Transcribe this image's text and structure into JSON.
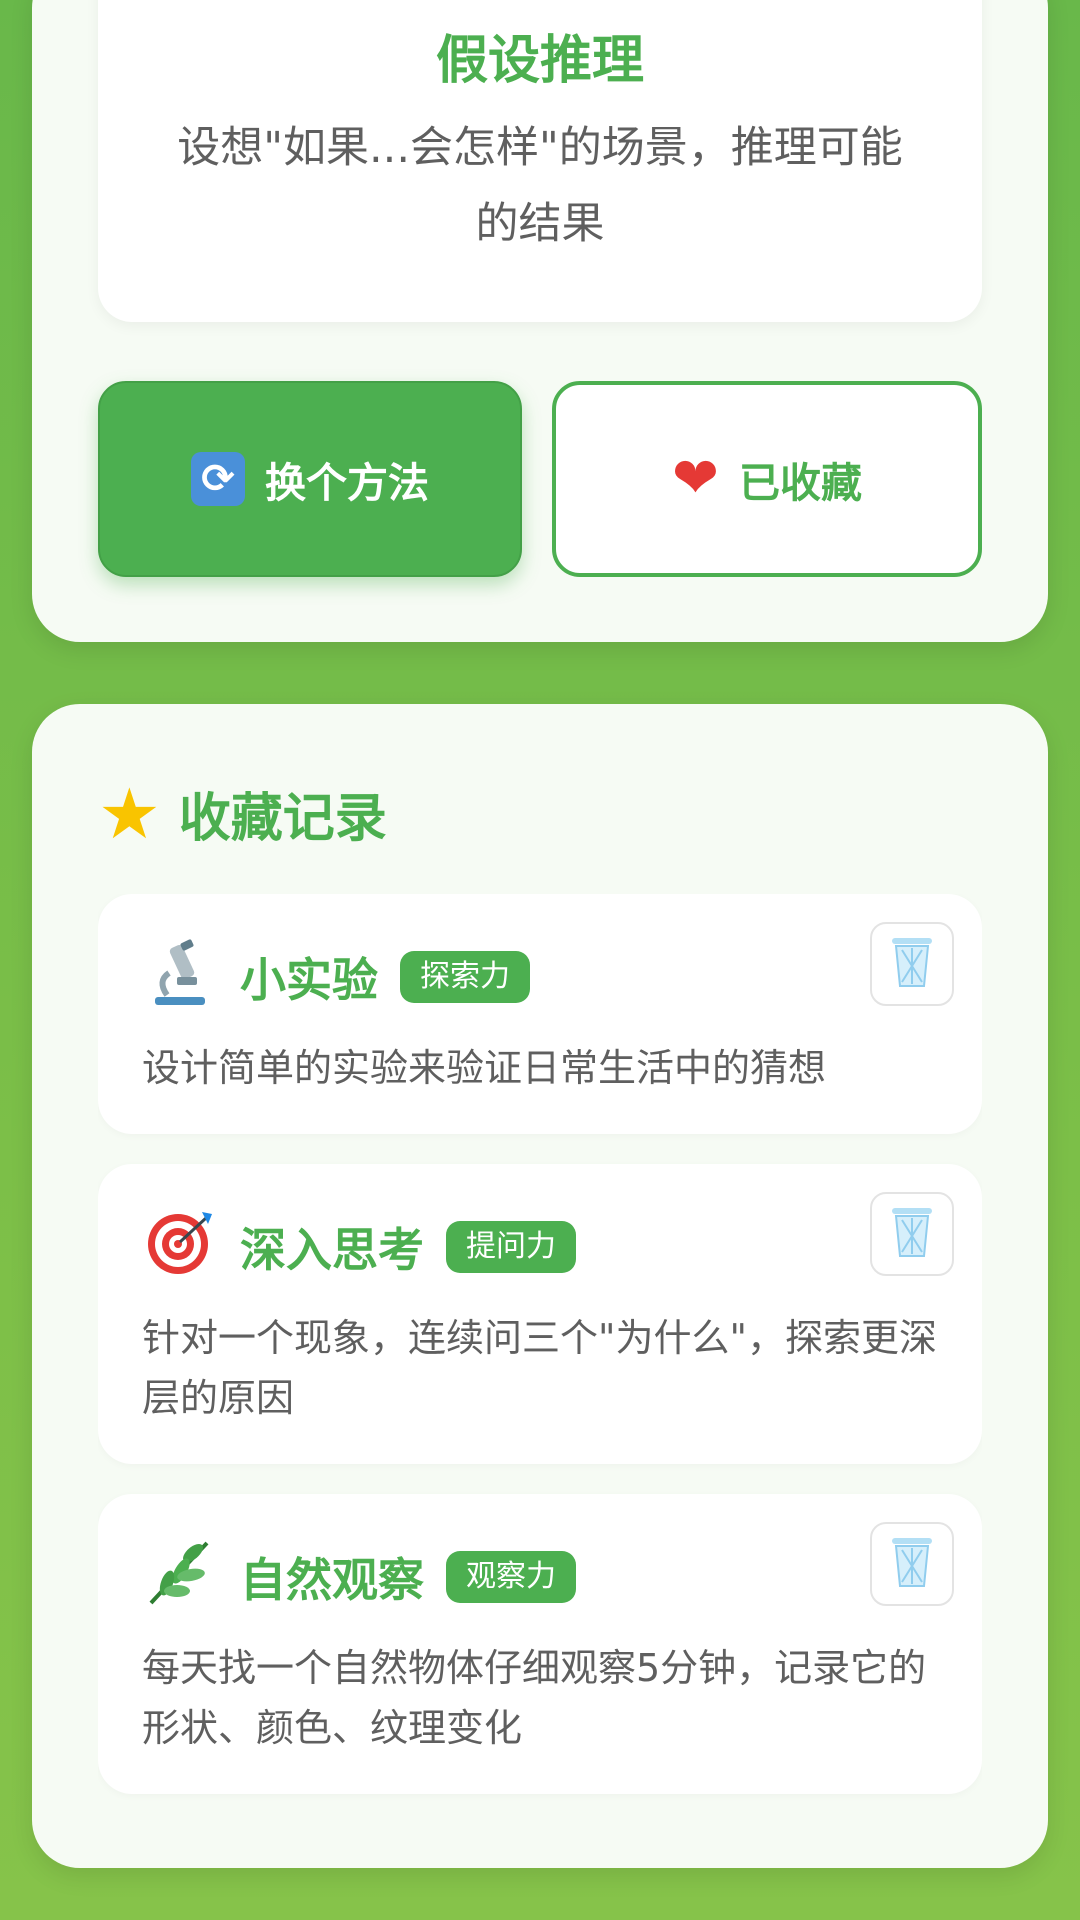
{
  "method": {
    "title": "假设推理",
    "description": "设想\"如果...会怎样\"的场景，推理可能的结果"
  },
  "actions": {
    "switch_icon": "refresh-icon",
    "switch_label": "换个方法",
    "favorite_icon": "heart-icon",
    "favorite_label": "已收藏"
  },
  "favorites": {
    "header_icon": "star-icon",
    "title": "收藏记录",
    "items": [
      {
        "icon": "microscope-icon",
        "name": "小实验",
        "tag": "探索力",
        "description": "设计简单的实验来验证日常生活中的猜想"
      },
      {
        "icon": "target-icon",
        "name": "深入思考",
        "tag": "提问力",
        "description": "针对一个现象，连续问三个\"为什么\"，探索更深层的原因"
      },
      {
        "icon": "leaf-icon",
        "name": "自然观察",
        "tag": "观察力",
        "description": "每天找一个自然物体仔细观察5分钟，记录它的形状、颜色、纹理变化"
      }
    ]
  },
  "colors": {
    "accent": "#4caf50",
    "background": "#7cbf48",
    "text": "#5f5f5f",
    "heart": "#e53935"
  }
}
